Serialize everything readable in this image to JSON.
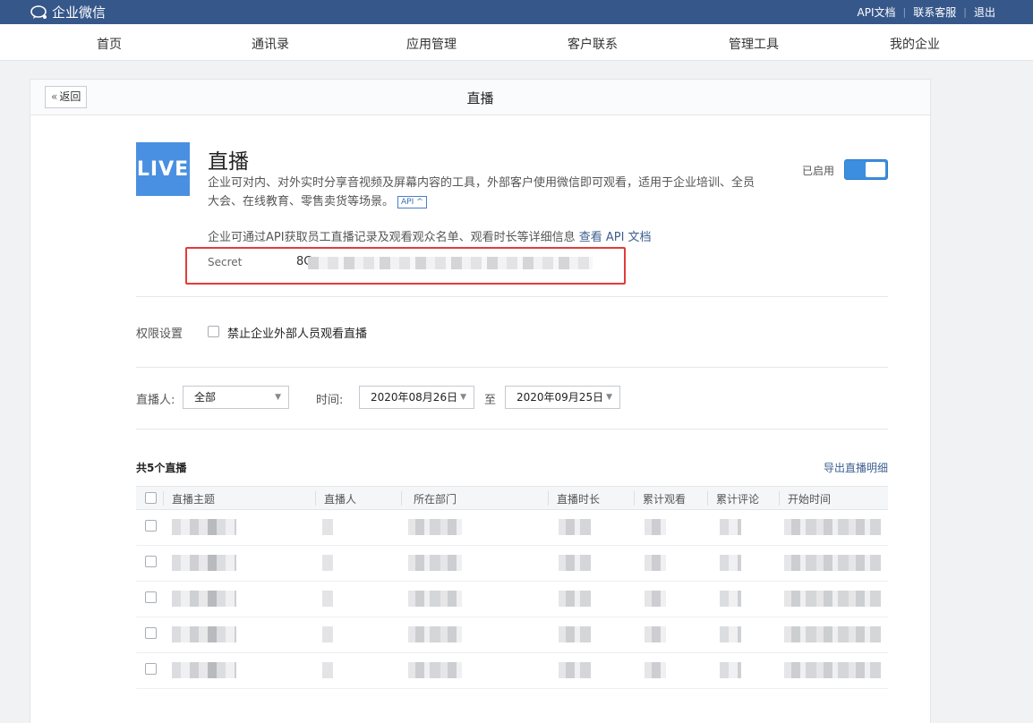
{
  "topbar": {
    "brand": "企业微信",
    "links": [
      "API文档",
      "联系客服",
      "退出"
    ]
  },
  "nav": {
    "items": [
      "首页",
      "通讯录",
      "应用管理",
      "客户联系",
      "管理工具",
      "我的企业"
    ]
  },
  "panel": {
    "back_label": "返回",
    "title": "直播"
  },
  "app": {
    "logo_text": "LIVE",
    "name": "直播",
    "description": "企业可对内、对外实时分享音视频及屏幕内容的工具，外部客户使用微信即可观看，适用于企业培训、全员大会、在线教育、零售卖货等场景。",
    "api_tag": "API ^",
    "api_info": "企业可通过API获取员工直播记录及观看观众名单、观看时长等详细信息",
    "api_link": "查看 API 文档",
    "secret_label": "Secret",
    "secret_value": "8C",
    "status_label": "已启用",
    "enabled": true
  },
  "permissions": {
    "label": "权限设置",
    "option": "禁止企业外部人员观看直播",
    "checked": false
  },
  "filters": {
    "streamer_label": "直播人:",
    "streamer_value": "全部",
    "time_label": "时间:",
    "start_date": "2020年08月26日",
    "to_label": "至",
    "end_date": "2020年09月25日"
  },
  "table": {
    "count_label": "共5个直播",
    "export_label": "导出直播明细",
    "columns": [
      "直播主题",
      "直播人",
      "所在部门",
      "直播时长",
      "累计观看",
      "累计评论",
      "开始时间"
    ],
    "row_count": 5
  },
  "colors": {
    "topbar": "#36578a",
    "accent": "#3c8ee0",
    "highlight": "#e23b3b"
  }
}
